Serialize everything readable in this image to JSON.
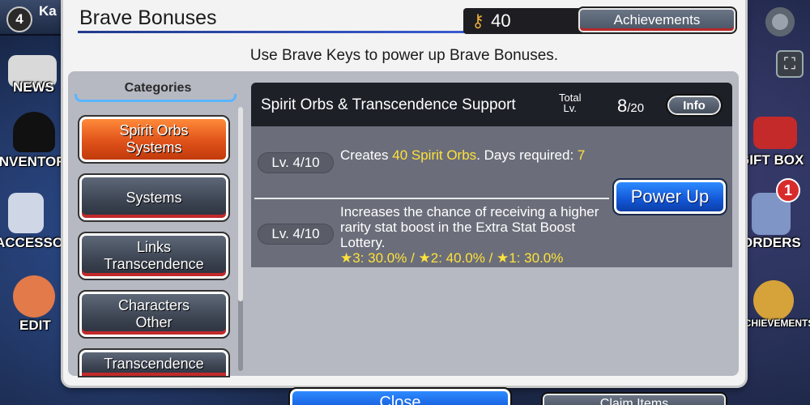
{
  "background": {
    "player_level": "4",
    "player_name": "Ka",
    "left_menu": [
      "NEWS",
      "INVENTORY",
      "ACCESSORIES",
      "EDIT"
    ],
    "right_menu": [
      "GIFT BOX",
      "ORDERS",
      "ACHIEVEMENTS"
    ],
    "orders_badge": "1"
  },
  "modal": {
    "title": "Brave Bonuses",
    "brave_keys_count": "40",
    "achievements_label": "Achievements",
    "instruction": "Use Brave Keys to power up Brave Bonuses."
  },
  "categories": {
    "header": "Categories",
    "items": [
      {
        "line1": "Spirit Orbs",
        "line2": "Systems",
        "active": true
      },
      {
        "line1": "Systems",
        "line2": "",
        "active": false
      },
      {
        "line1": "Links",
        "line2": "Transcendence",
        "active": false
      },
      {
        "line1": "Characters",
        "line2": "Other",
        "active": false
      },
      {
        "line1": "Transcendence",
        "line2": "",
        "active": false
      }
    ]
  },
  "detail": {
    "title": "Spirit Orbs & Transcendence Support",
    "total_lv_label_1": "Total",
    "total_lv_label_2": "Lv.",
    "total_lv_current": "8",
    "total_lv_max": "/20",
    "info_label": "Info",
    "bonus1": {
      "level": "Lv. 4/10",
      "text_pre": "Creates ",
      "text_hl": "40 Spirit Orbs",
      "text_mid": ". Days required: ",
      "text_hl2": "7"
    },
    "bonus2": {
      "level": "Lv. 4/10",
      "text": "Increases the chance of receiving a higher rarity stat boost in the Extra Stat Boost Lottery.",
      "text_hl": "★3: 30.0% / ★2: 40.0% / ★1: 30.0%"
    },
    "power_up_label": "Power Up"
  },
  "footer": {
    "close_label": "Close",
    "claim_label": "Claim Items"
  },
  "colors": {
    "accent_orange": "#e0521a",
    "accent_blue": "#1256d6",
    "highlight_yellow": "#ffe23a"
  }
}
